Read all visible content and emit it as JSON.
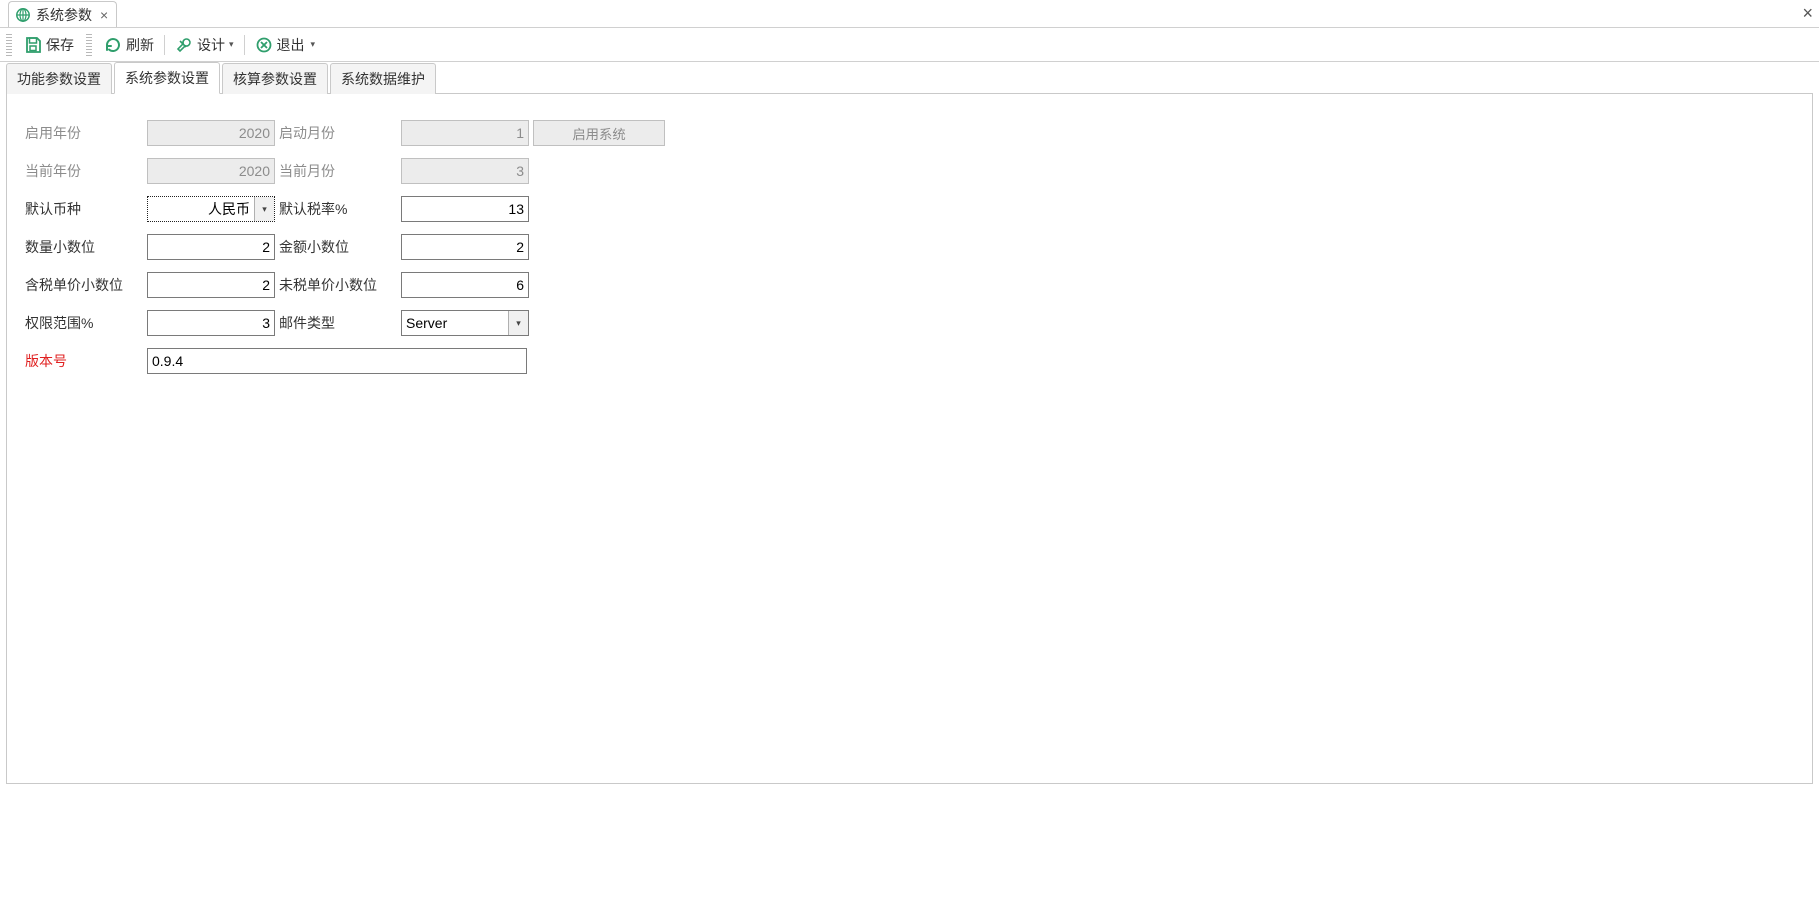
{
  "doc_tab": {
    "title": "系统参数"
  },
  "toolbar": {
    "save": "保存",
    "refresh": "刷新",
    "design": "设计",
    "exit": "退出"
  },
  "inner_tabs": [
    {
      "label": "功能参数设置"
    },
    {
      "label": "系统参数设置"
    },
    {
      "label": "核算参数设置"
    },
    {
      "label": "系统数据维护"
    }
  ],
  "form": {
    "labels": {
      "enable_year": "启用年份",
      "start_month": "启动月份",
      "enable_sys_btn": "启用系统",
      "current_year": "当前年份",
      "current_month": "当前月份",
      "default_currency": "默认币种",
      "default_tax_rate": "默认税率%",
      "qty_decimals": "数量小数位",
      "amount_decimals": "金额小数位",
      "tax_price_decimals": "含税单价小数位",
      "notax_price_decimals": "未税单价小数位",
      "perm_scope": "权限范围%",
      "mail_type": "邮件类型",
      "version": "版本号"
    },
    "values": {
      "enable_year": "2020",
      "start_month": "1",
      "current_year": "2020",
      "current_month": "3",
      "default_currency": "人民币",
      "default_tax_rate": "13",
      "qty_decimals": "2",
      "amount_decimals": "2",
      "tax_price_decimals": "2",
      "notax_price_decimals": "6",
      "perm_scope": "3",
      "mail_type": "Server",
      "version": "0.9.4"
    }
  }
}
